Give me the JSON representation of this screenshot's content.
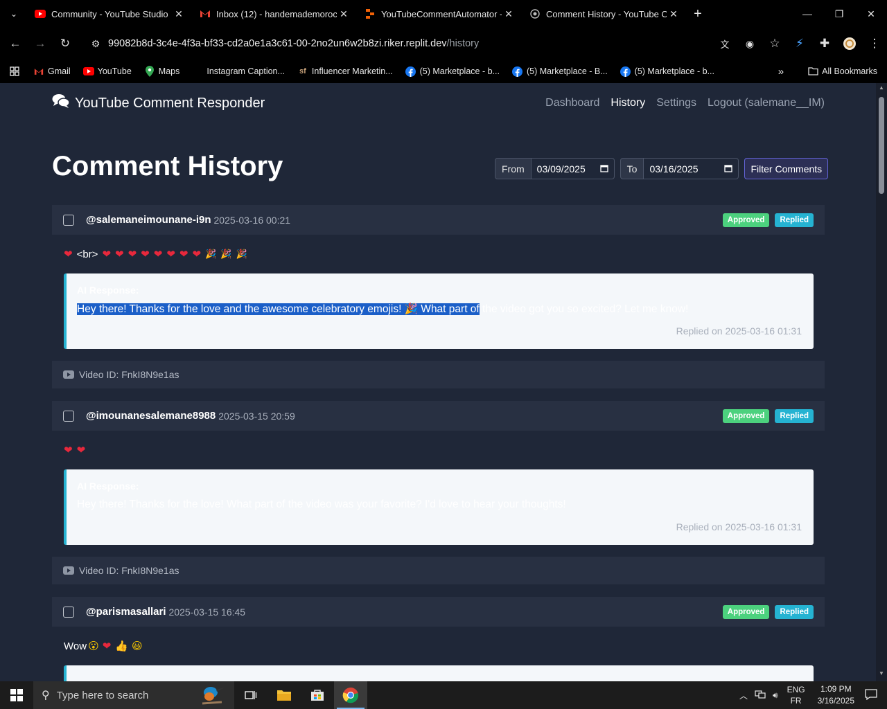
{
  "browser": {
    "tabs": [
      {
        "title": "Community - YouTube Studio",
        "icon": "youtube-icon"
      },
      {
        "title": "Inbox (12) - handemademoroc",
        "icon": "gmail-icon"
      },
      {
        "title": "YouTubeCommentAutomator -",
        "icon": "replit-icon"
      },
      {
        "title": "Comment History - YouTube Co",
        "icon": "globe-icon"
      }
    ],
    "url_host": "99082b8d-3c4e-4f3a-bf33-cd2a0e1a3c61-00-2no2un6w2b8zi.riker.replit.dev",
    "url_path": "/history",
    "bookmarks": [
      {
        "label": "Gmail",
        "icon": "gmail-icon"
      },
      {
        "label": "YouTube",
        "icon": "youtube-icon"
      },
      {
        "label": "Maps",
        "icon": "maps-icon"
      },
      {
        "label": "Instagram Caption...",
        "icon": "blank-icon"
      },
      {
        "label": "Influencer Marketin...",
        "icon": "sf-icon"
      },
      {
        "label": "(5) Marketplace - b...",
        "icon": "facebook-icon"
      },
      {
        "label": "(5) Marketplace - B...",
        "icon": "facebook-icon"
      },
      {
        "label": "(5) Marketplace - b...",
        "icon": "facebook-icon"
      }
    ],
    "all_bookmarks": "All Bookmarks"
  },
  "app": {
    "brand": "YouTube Comment Responder",
    "nav": [
      "Dashboard",
      "History",
      "Settings",
      "Logout (salemane__IM)"
    ],
    "active_nav": "History",
    "page_title": "Comment History",
    "filter": {
      "from_label": "From",
      "from_value": "03/09/2025",
      "to_label": "To",
      "to_value": "03/16/2025",
      "button": "Filter Comments"
    },
    "comments": [
      {
        "author": "@salemaneimounane-i9n",
        "date": "2025-03-16 00:21",
        "badges": [
          "Approved",
          "Replied"
        ],
        "text_prefix": "<br>",
        "ai_label": "AI Response:",
        "ai_selected": "Hey there! Thanks for the love and the awesome celebratory emojis! 🎉 What part of",
        "ai_rest": " the video got you so excited? Let me know!",
        "replied_on": "Replied on 2025-03-16 01:31",
        "video_id": "Video ID: FnkI8N9e1as"
      },
      {
        "author": "@imounanesalemane8988",
        "date": "2025-03-15 20:59",
        "badges": [
          "Approved",
          "Replied"
        ],
        "ai_label": "AI Response:",
        "ai_text": "Hey there! Thanks for the love! What part of the video was your favorite? I'd love to hear your thoughts!",
        "replied_on": "Replied on 2025-03-16 01:31",
        "video_id": "Video ID: FnkI8N9e1as"
      },
      {
        "author": "@parismasallari",
        "date": "2025-03-15 16:45",
        "badges": [
          "Approved",
          "Replied"
        ],
        "text": "Wow"
      }
    ]
  },
  "taskbar": {
    "search_placeholder": "Type here to search",
    "lang_top": "ENG",
    "lang_bottom": "FR",
    "time": "1:09 PM",
    "date": "3/16/2025"
  },
  "colors": {
    "page_bg": "#1f2738",
    "card_header": "#283042",
    "approved": "#4cd17e",
    "replied": "#25b3d2",
    "filter_border": "#6364d8",
    "selection": "#1b5fc8"
  }
}
